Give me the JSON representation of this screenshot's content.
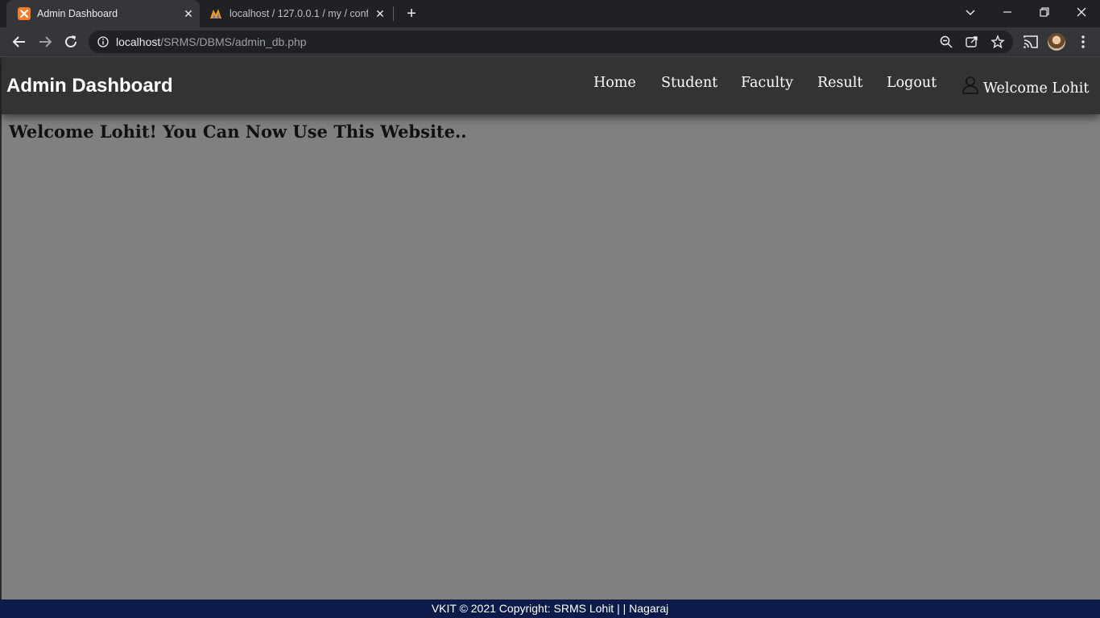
{
  "browser": {
    "tabs": [
      {
        "title": "Admin Dashboard",
        "favicon": "xampp-icon",
        "active": true
      },
      {
        "title": "localhost / 127.0.0.1 / my / conf |",
        "favicon": "phpmyadmin-icon",
        "active": false
      }
    ],
    "new_tab_label": "+",
    "url_host": "localhost",
    "url_path": "/SRMS/DBMS/admin_db.php"
  },
  "navbar": {
    "brand": "Admin Dashboard",
    "links": [
      "Home",
      "Student",
      "Faculty",
      "Result",
      "Logout"
    ],
    "welcome": "Welcome Lohit"
  },
  "main": {
    "heading": "Welcome Lohit! You Can Now Use This Website.."
  },
  "footer": {
    "text": "VKIT © 2021 Copyright: SRMS Lohit | | Nagaraj"
  },
  "colors": {
    "navbar_bg": "#333333",
    "page_bg": "#808080",
    "footer_bg": "#0d1b4a"
  }
}
